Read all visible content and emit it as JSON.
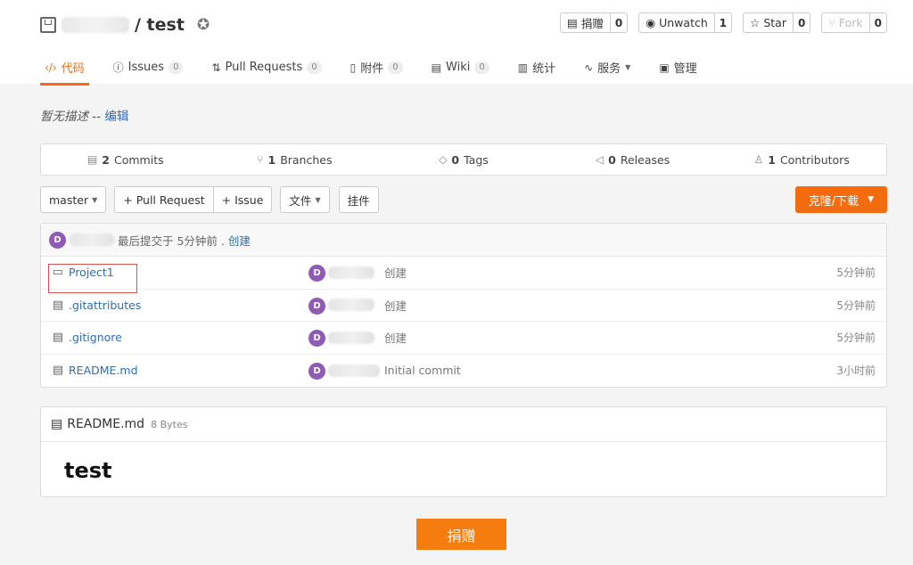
{
  "header": {
    "repo_separator": "/ test",
    "actions": [
      {
        "label": "捐赠",
        "count": "0"
      },
      {
        "label": "Unwatch",
        "count": "1"
      },
      {
        "label": "Star",
        "count": "0"
      },
      {
        "label": "Fork",
        "count": "0"
      }
    ]
  },
  "tabs": [
    {
      "label": "代码",
      "count": null
    },
    {
      "label": "Issues",
      "count": "0"
    },
    {
      "label": "Pull Requests",
      "count": "0"
    },
    {
      "label": "附件",
      "count": "0"
    },
    {
      "label": "Wiki",
      "count": "0"
    },
    {
      "label": "统计",
      "count": null
    },
    {
      "label": "服务",
      "count": null
    },
    {
      "label": "管理",
      "count": null
    }
  ],
  "description": {
    "text": "暂无描述 -- ",
    "edit_link": "编辑"
  },
  "stats": [
    {
      "count": "2",
      "label": "Commits"
    },
    {
      "count": "1",
      "label": "Branches"
    },
    {
      "count": "0",
      "label": "Tags"
    },
    {
      "count": "0",
      "label": "Releases"
    },
    {
      "count": "1",
      "label": "Contributors"
    }
  ],
  "toolbar": {
    "branch": "master",
    "pull_request": "+ Pull Request",
    "issue": "+ Issue",
    "files": "文件",
    "widgets": "挂件",
    "clone": "克隆/下载"
  },
  "latest_commit": {
    "avatar": "D",
    "text": "最后提交于 5分钟前 .",
    "message": "创建"
  },
  "files": [
    {
      "type": "folder",
      "name": "Project1",
      "avatar": "D",
      "message": "创建",
      "time": "5分钟前"
    },
    {
      "type": "file",
      "name": ".gitattributes",
      "avatar": "D",
      "message": "创建",
      "time": "5分钟前"
    },
    {
      "type": "file",
      "name": ".gitignore",
      "avatar": "D",
      "message": "创建",
      "time": "5分钟前"
    },
    {
      "type": "file",
      "name": "README.md",
      "avatar": "D",
      "message": "Initial commit",
      "time": "3小时前"
    }
  ],
  "readme": {
    "filename": "README.md",
    "size": "8 Bytes",
    "heading": "test"
  },
  "donate_button": "捐赠"
}
